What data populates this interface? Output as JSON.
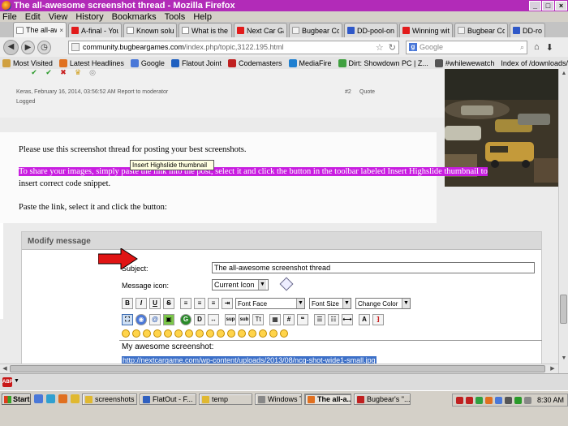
{
  "window": {
    "title": "The all-awesome screenshot thread - Mozilla Firefox"
  },
  "menu": [
    "File",
    "Edit",
    "View",
    "History",
    "Bookmarks",
    "Tools",
    "Help"
  ],
  "tabs": [
    {
      "label": "The all-aw...",
      "icon": "page",
      "active": true
    },
    {
      "label": "A-final - YouT...",
      "icon": "youtube"
    },
    {
      "label": "Known solutio...",
      "icon": "page"
    },
    {
      "label": "What is the m...",
      "icon": "page"
    },
    {
      "label": "Next Car Gam...",
      "icon": "youtube"
    },
    {
      "label": "Bugbear Com...",
      "icon": "bugbear"
    },
    {
      "label": "DD-pool-onlin...",
      "icon": "dd"
    },
    {
      "label": "Winning with ...",
      "icon": "youtube"
    },
    {
      "label": "Bugbear Com...",
      "icon": "bugbear"
    },
    {
      "label": "DD-roof",
      "icon": "dd"
    }
  ],
  "navbar": {
    "url_domain": "community.bugbeargames.com",
    "url_path": "/index.php/topic,3122.195.html",
    "search_placeholder": "Google"
  },
  "bookmarks": [
    {
      "label": "Most Visited",
      "color": "#d0a040"
    },
    {
      "label": "Latest Headlines",
      "color": "#e07020"
    },
    {
      "label": "Google",
      "color": "#4a78d8"
    },
    {
      "label": "Flatout Joint",
      "color": "#2060c0"
    },
    {
      "label": "Codemasters",
      "color": "#c02020"
    },
    {
      "label": "MediaFire",
      "color": "#2080d0"
    },
    {
      "label": "Dirt: Showdown PC | Z...",
      "color": "#40a040"
    },
    {
      "label": "#whilewewatch",
      "color": "#555555"
    },
    {
      "label": "Index of /downloads/p...",
      "color": "#e0e0e0"
    }
  ],
  "prev_post": {
    "meta": "Keras, February 16, 2014, 03:56:52 AM",
    "report": "Report to moderator",
    "logged": "Logged",
    "post_num": "#2",
    "quote": "Quote"
  },
  "post": {
    "line1": "Please use this screenshot thread for posting your best screenshots.",
    "line2": "To share your images, simply paste the link into the post, select it and click the button in the toolbar labeled Insert Highslide thumbnail to",
    "line3": "insert correct code snippet.",
    "line4": "Paste the link, select it and click the button:"
  },
  "modify": {
    "header": "Modify message",
    "subject_label": "Subject:",
    "subject_value": "The all-awesome screenshot thread",
    "icon_label": "Message icon:",
    "icon_value": "Current Icon",
    "font_face": "Font Face",
    "font_size": "Font Size",
    "font_color": "Change Color",
    "tooltip": "Insert Highslide thumbnail",
    "message_line": "My awesome screenshot:",
    "message_link": "http://nextcargame.com/wp-content/uploads/2013/08/ncg-shot-wide1-small.jpg"
  },
  "toolbar1": [
    "B",
    "I",
    "U",
    "S"
  ],
  "toolbar2_text": {
    "sup": "sup",
    "sub": "sub",
    "tt": "Tt",
    "hash": "#"
  },
  "taskbar": {
    "start": "Start",
    "tasks": [
      {
        "label": "screenshots",
        "color": "#e0b830"
      },
      {
        "label": "FlatOut - F...",
        "color": "#3060c0"
      },
      {
        "label": "temp",
        "color": "#e0b830"
      },
      {
        "label": "Windows T...",
        "color": "#888888"
      },
      {
        "label": "The all-a...",
        "color": "#e07020",
        "active": true
      },
      {
        "label": "Bugbear's \"...",
        "color": "#c02020"
      }
    ],
    "clock": "8:30 AM"
  }
}
